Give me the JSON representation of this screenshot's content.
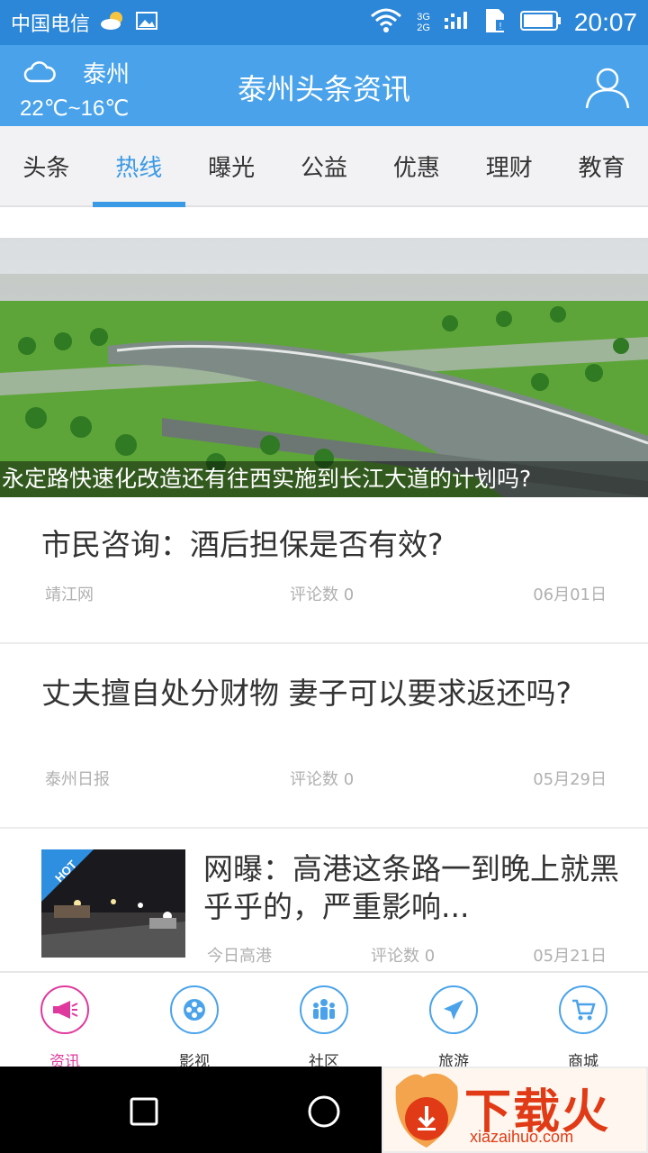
{
  "status_bar": {
    "carrier": "中国电信",
    "network_label_top": "3G",
    "network_label_bottom": "2G",
    "time": "20:07"
  },
  "header": {
    "city": "泰州",
    "temperature": "22℃~16℃",
    "title": "泰州头条资讯",
    "weather_icon": "cloud-icon",
    "user_icon": "user-icon"
  },
  "tabs": [
    {
      "label": "头条",
      "active": false
    },
    {
      "label": "热线",
      "active": true
    },
    {
      "label": "曝光",
      "active": false
    },
    {
      "label": "公益",
      "active": false
    },
    {
      "label": "优惠",
      "active": false
    },
    {
      "label": "理财",
      "active": false
    },
    {
      "label": "教育",
      "active": false
    }
  ],
  "banner": {
    "caption": "永定路快速化改造还有往西实施到长江大道的计划吗?"
  },
  "news": [
    {
      "title": "市民咨询：酒后担保是否有效?",
      "source": "靖江网",
      "comments": "评论数 0",
      "date": "06月01日"
    },
    {
      "title": "丈夫擅自处分财物 妻子可以要求返还吗?",
      "source": "泰州日报",
      "comments": "评论数 0",
      "date": "05月29日"
    },
    {
      "title": "网曝：高港这条路一到晚上就黑乎乎的，严重影响...",
      "source": "今日高港",
      "comments": "评论数 0",
      "date": "05月21日",
      "badge": "HOT"
    }
  ],
  "bottom_nav": [
    {
      "label": "资讯",
      "icon": "megaphone-icon",
      "active": true
    },
    {
      "label": "影视",
      "icon": "film-reel-icon",
      "active": false
    },
    {
      "label": "社区",
      "icon": "people-icon",
      "active": false
    },
    {
      "label": "旅游",
      "icon": "airplane-icon",
      "active": false
    },
    {
      "label": "商城",
      "icon": "cart-icon",
      "active": false
    }
  ],
  "watermark": {
    "brand": "下载火",
    "url": "xiazaihuo.com"
  },
  "colors": {
    "status_bar": "#2c87d8",
    "header": "#4aa3ea",
    "tab_active": "#3a9ae5",
    "nav_active": "#e0399d"
  }
}
